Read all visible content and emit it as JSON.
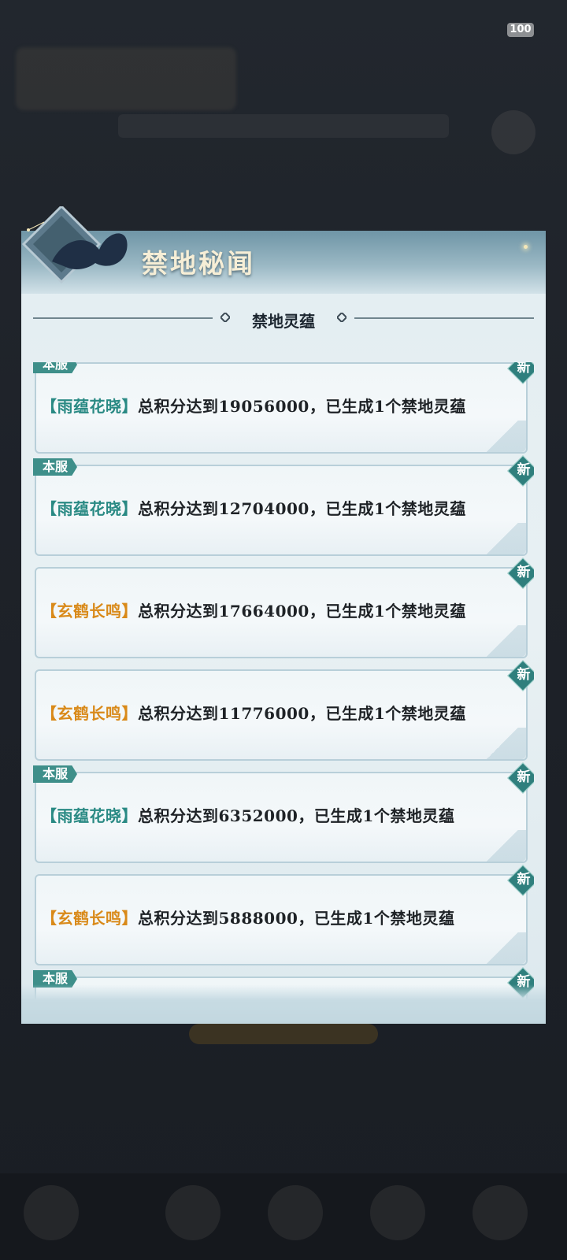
{
  "status": {
    "battery": "100"
  },
  "dialog": {
    "title": "禁地秘闻",
    "section_title": "禁地灵蕴"
  },
  "items": [
    {
      "tag": "本服",
      "team": "【雨蕴花晓】",
      "text": "总积分达到19056000，已生成1个禁地灵蕴",
      "new": "新",
      "team_color": "#2a8a84"
    },
    {
      "tag": "本服",
      "team": "【雨蕴花晓】",
      "text": "总积分达到12704000，已生成1个禁地灵蕴",
      "new": "新",
      "team_color": "#2a8a84"
    },
    {
      "tag": "",
      "team": "【玄鹤长鸣】",
      "text": "总积分达到17664000，已生成1个禁地灵蕴",
      "new": "新",
      "team_color": "#d98a1a"
    },
    {
      "tag": "",
      "team": "【玄鹤长鸣】",
      "text": "总积分达到11776000，已生成1个禁地灵蕴",
      "new": "新",
      "team_color": "#d98a1a"
    },
    {
      "tag": "本服",
      "team": "【雨蕴花晓】",
      "text": "总积分达到6352000，已生成1个禁地灵蕴",
      "new": "新",
      "team_color": "#2a8a84"
    },
    {
      "tag": "",
      "team": "【玄鹤长鸣】",
      "text": "总积分达到5888000，已生成1个禁地灵蕴",
      "new": "新",
      "team_color": "#d98a1a"
    },
    {
      "tag": "本服",
      "team": "",
      "text": "",
      "new": "新",
      "team_color": "#2a8a84"
    }
  ]
}
